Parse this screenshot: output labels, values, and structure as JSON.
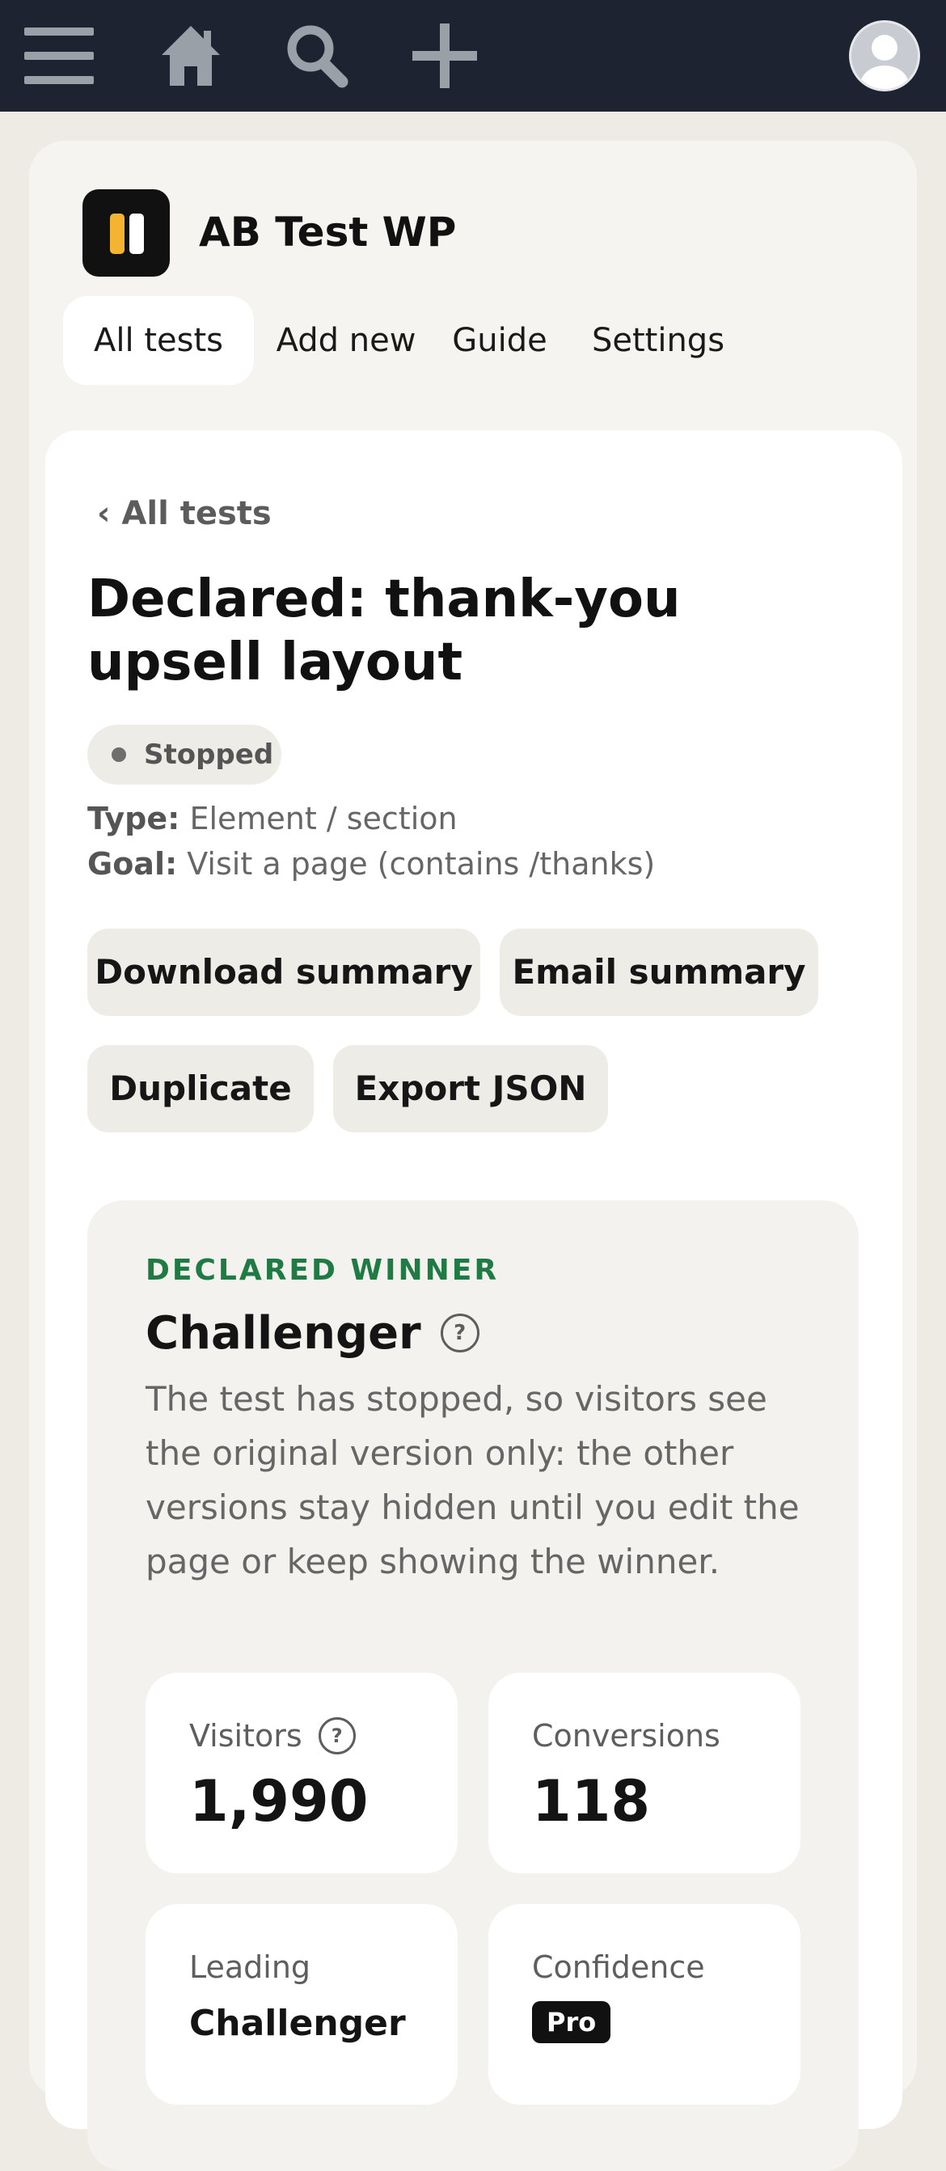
{
  "topbar": {
    "icons": [
      "menu-icon",
      "home-icon",
      "search-icon",
      "plus-icon",
      "avatar-icon"
    ],
    "background": "#1d2330"
  },
  "plugin": {
    "name": "AB Test WP",
    "logo_colors": [
      "#f4b431",
      "#ffffff"
    ]
  },
  "tabs": [
    {
      "label": "All tests",
      "active": true
    },
    {
      "label": "Add new",
      "active": false
    },
    {
      "label": "Guide",
      "active": false
    },
    {
      "label": "Settings",
      "active": false
    }
  ],
  "test": {
    "back_label": "‹ All tests",
    "title": "Declared: thank-you upsell layout",
    "status": "Stopped",
    "type_label": "Type:",
    "type_value": "Element / section",
    "goal_label": "Goal:",
    "goal_value": "Visit a page (contains /thanks)"
  },
  "actions": {
    "download": "Download summary",
    "email": "Email summary",
    "duplicate": "Duplicate",
    "export": "Export JSON"
  },
  "winner": {
    "eyebrow": "DECLARED WINNER",
    "name": "Challenger",
    "help": "?",
    "description": "The test has stopped, so visitors see the original version only: the other versions stay hidden until you edit the page or keep showing the winner.",
    "accent": "#1f7a44"
  },
  "stats": {
    "visitors_label": "Visitors",
    "visitors_value": "1,990",
    "conversions_label": "Conversions",
    "conversions_value": "118",
    "leading_label": "Leading",
    "leading_value": "Challenger",
    "confidence_label": "Confidence",
    "confidence_badge": "Pro"
  }
}
